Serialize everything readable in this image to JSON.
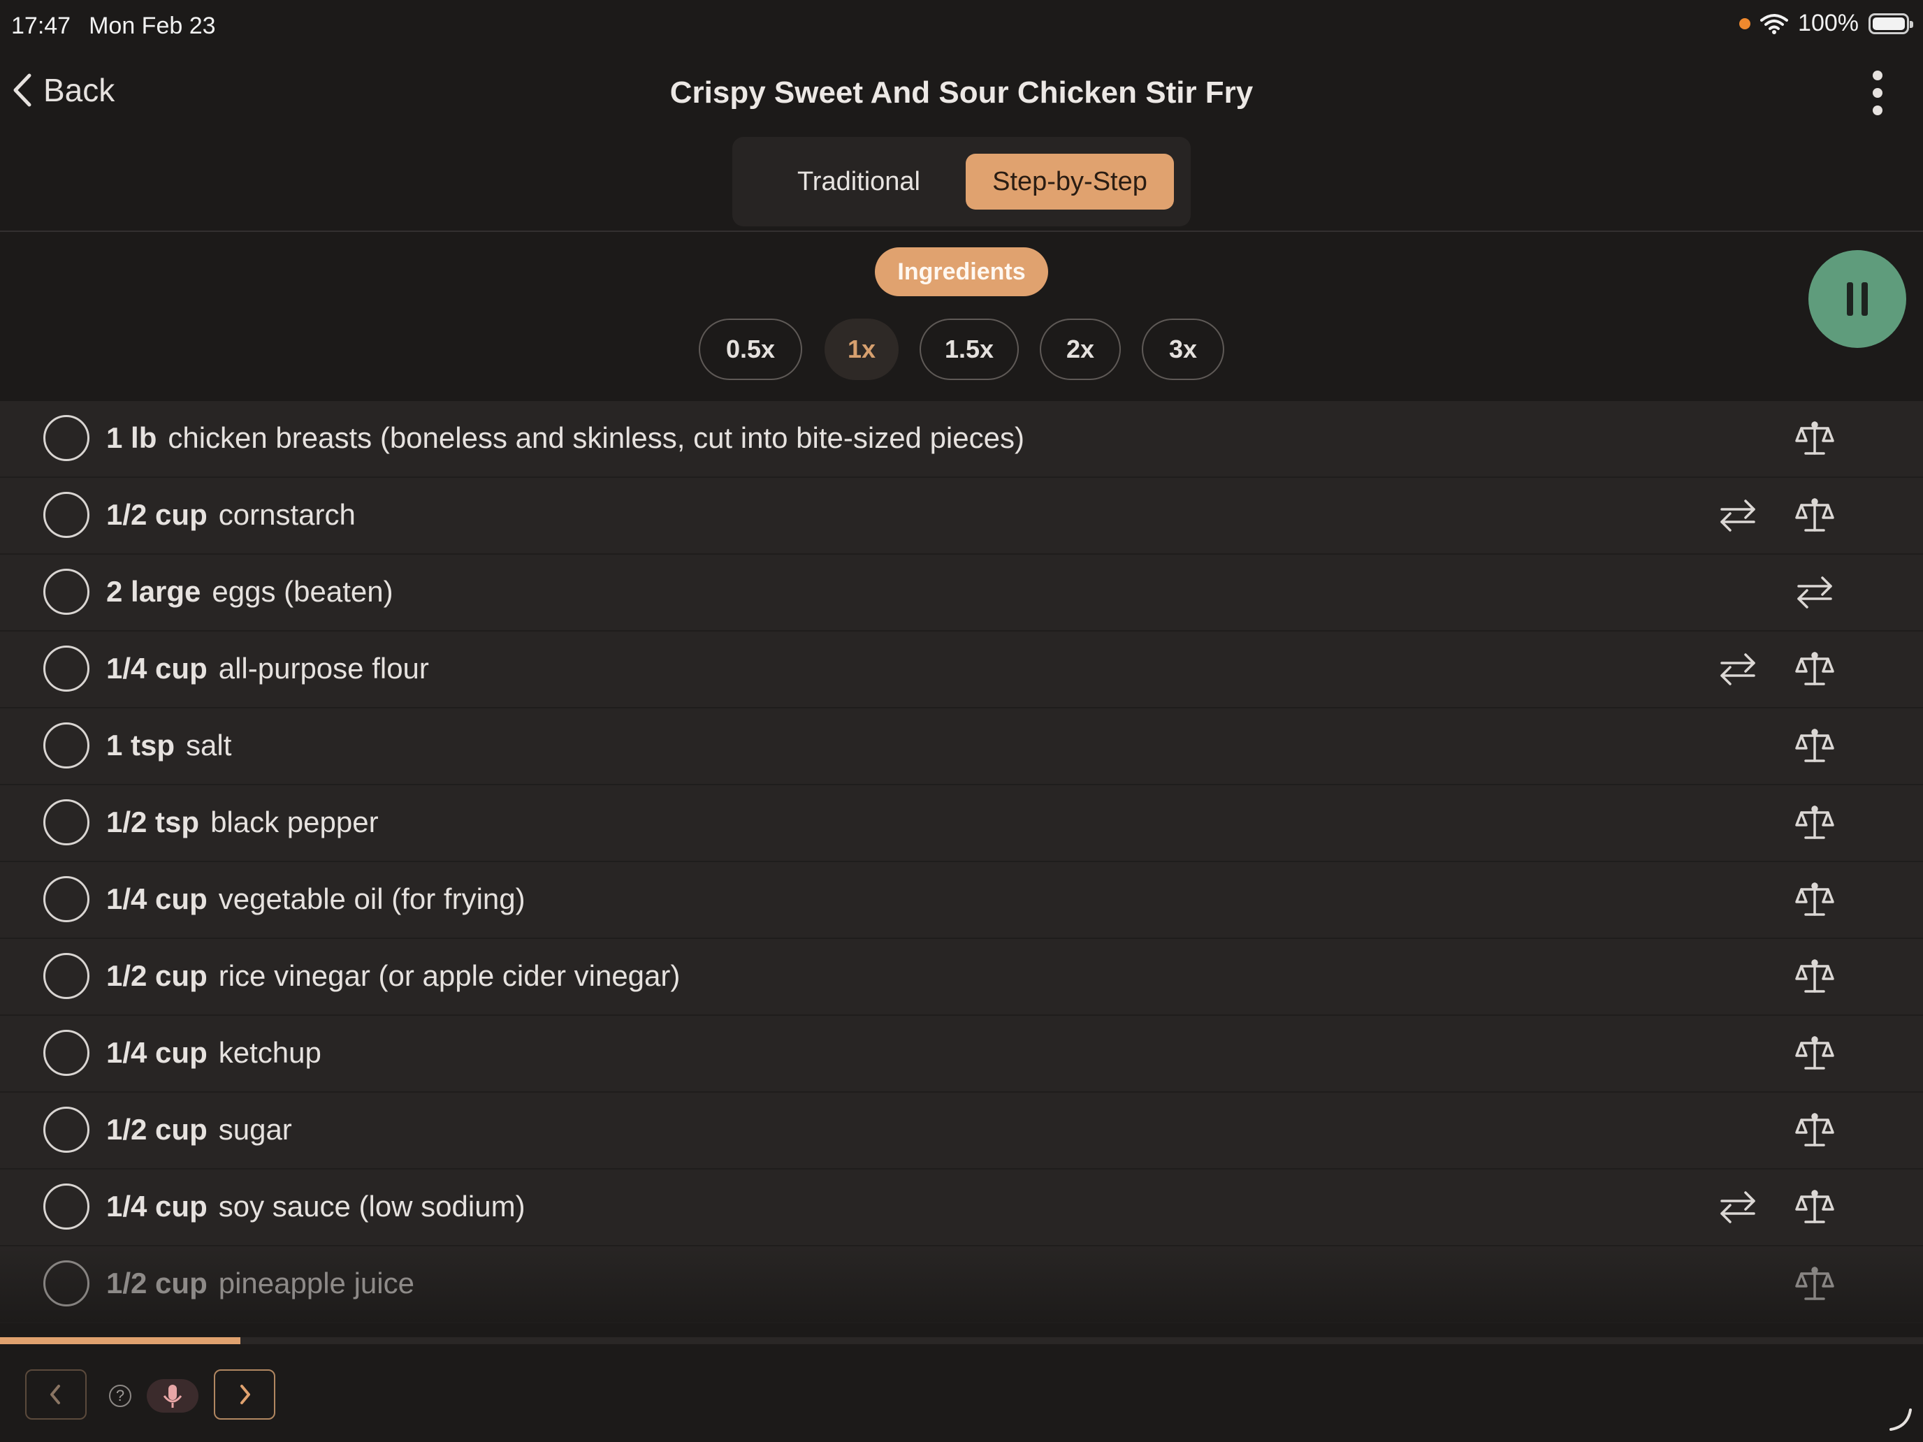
{
  "status_bar": {
    "time": "17:47",
    "date": "Mon Feb 23",
    "battery": "100%"
  },
  "header": {
    "back_label": "Back",
    "title": "Crispy Sweet And Sour Chicken Stir Fry"
  },
  "mode_tabs": [
    {
      "label": "Traditional",
      "selected": false
    },
    {
      "label": "Step-by-Step",
      "selected": true
    }
  ],
  "section_label": "Ingredients",
  "scales": [
    {
      "label": "0.5x",
      "selected": false
    },
    {
      "label": "1x",
      "selected": true
    },
    {
      "label": "1.5x",
      "selected": false
    },
    {
      "label": "2x",
      "selected": false
    },
    {
      "label": "3x",
      "selected": false
    }
  ],
  "ingredients": [
    {
      "qty": "1 lb",
      "name": "chicken breasts (boneless and skinless, cut into bite-sized pieces)",
      "actions": [
        "scale-icon"
      ]
    },
    {
      "qty": "1/2 cup",
      "name": "cornstarch",
      "actions": [
        "swap-icon",
        "scale-icon"
      ]
    },
    {
      "qty": "2 large",
      "name": "eggs (beaten)",
      "actions": [
        "swap-icon"
      ]
    },
    {
      "qty": "1/4 cup",
      "name": "all-purpose flour",
      "actions": [
        "swap-icon",
        "scale-icon"
      ]
    },
    {
      "qty": "1 tsp",
      "name": "salt",
      "actions": [
        "scale-icon"
      ]
    },
    {
      "qty": "1/2 tsp",
      "name": "black pepper",
      "actions": [
        "scale-icon"
      ]
    },
    {
      "qty": "1/4 cup",
      "name": "vegetable oil (for frying)",
      "actions": [
        "scale-icon"
      ]
    },
    {
      "qty": "1/2 cup",
      "name": "rice vinegar (or apple cider vinegar)",
      "actions": [
        "scale-icon"
      ]
    },
    {
      "qty": "1/4 cup",
      "name": "ketchup",
      "actions": [
        "scale-icon"
      ]
    },
    {
      "qty": "1/2 cup",
      "name": "sugar",
      "actions": [
        "scale-icon"
      ]
    },
    {
      "qty": "1/4 cup",
      "name": "soy sauce (low sodium)",
      "actions": [
        "swap-icon",
        "scale-icon"
      ]
    },
    {
      "qty": "1/2 cup",
      "name": "pineapple juice",
      "actions": [
        "scale-icon"
      ]
    }
  ],
  "progress": 0.125,
  "footer": {
    "help_symbol": "?"
  },
  "colors": {
    "accent": "#e0a26f",
    "pause_button": "#5f9c7c",
    "background": "#1c1a19",
    "row": "#282524"
  }
}
